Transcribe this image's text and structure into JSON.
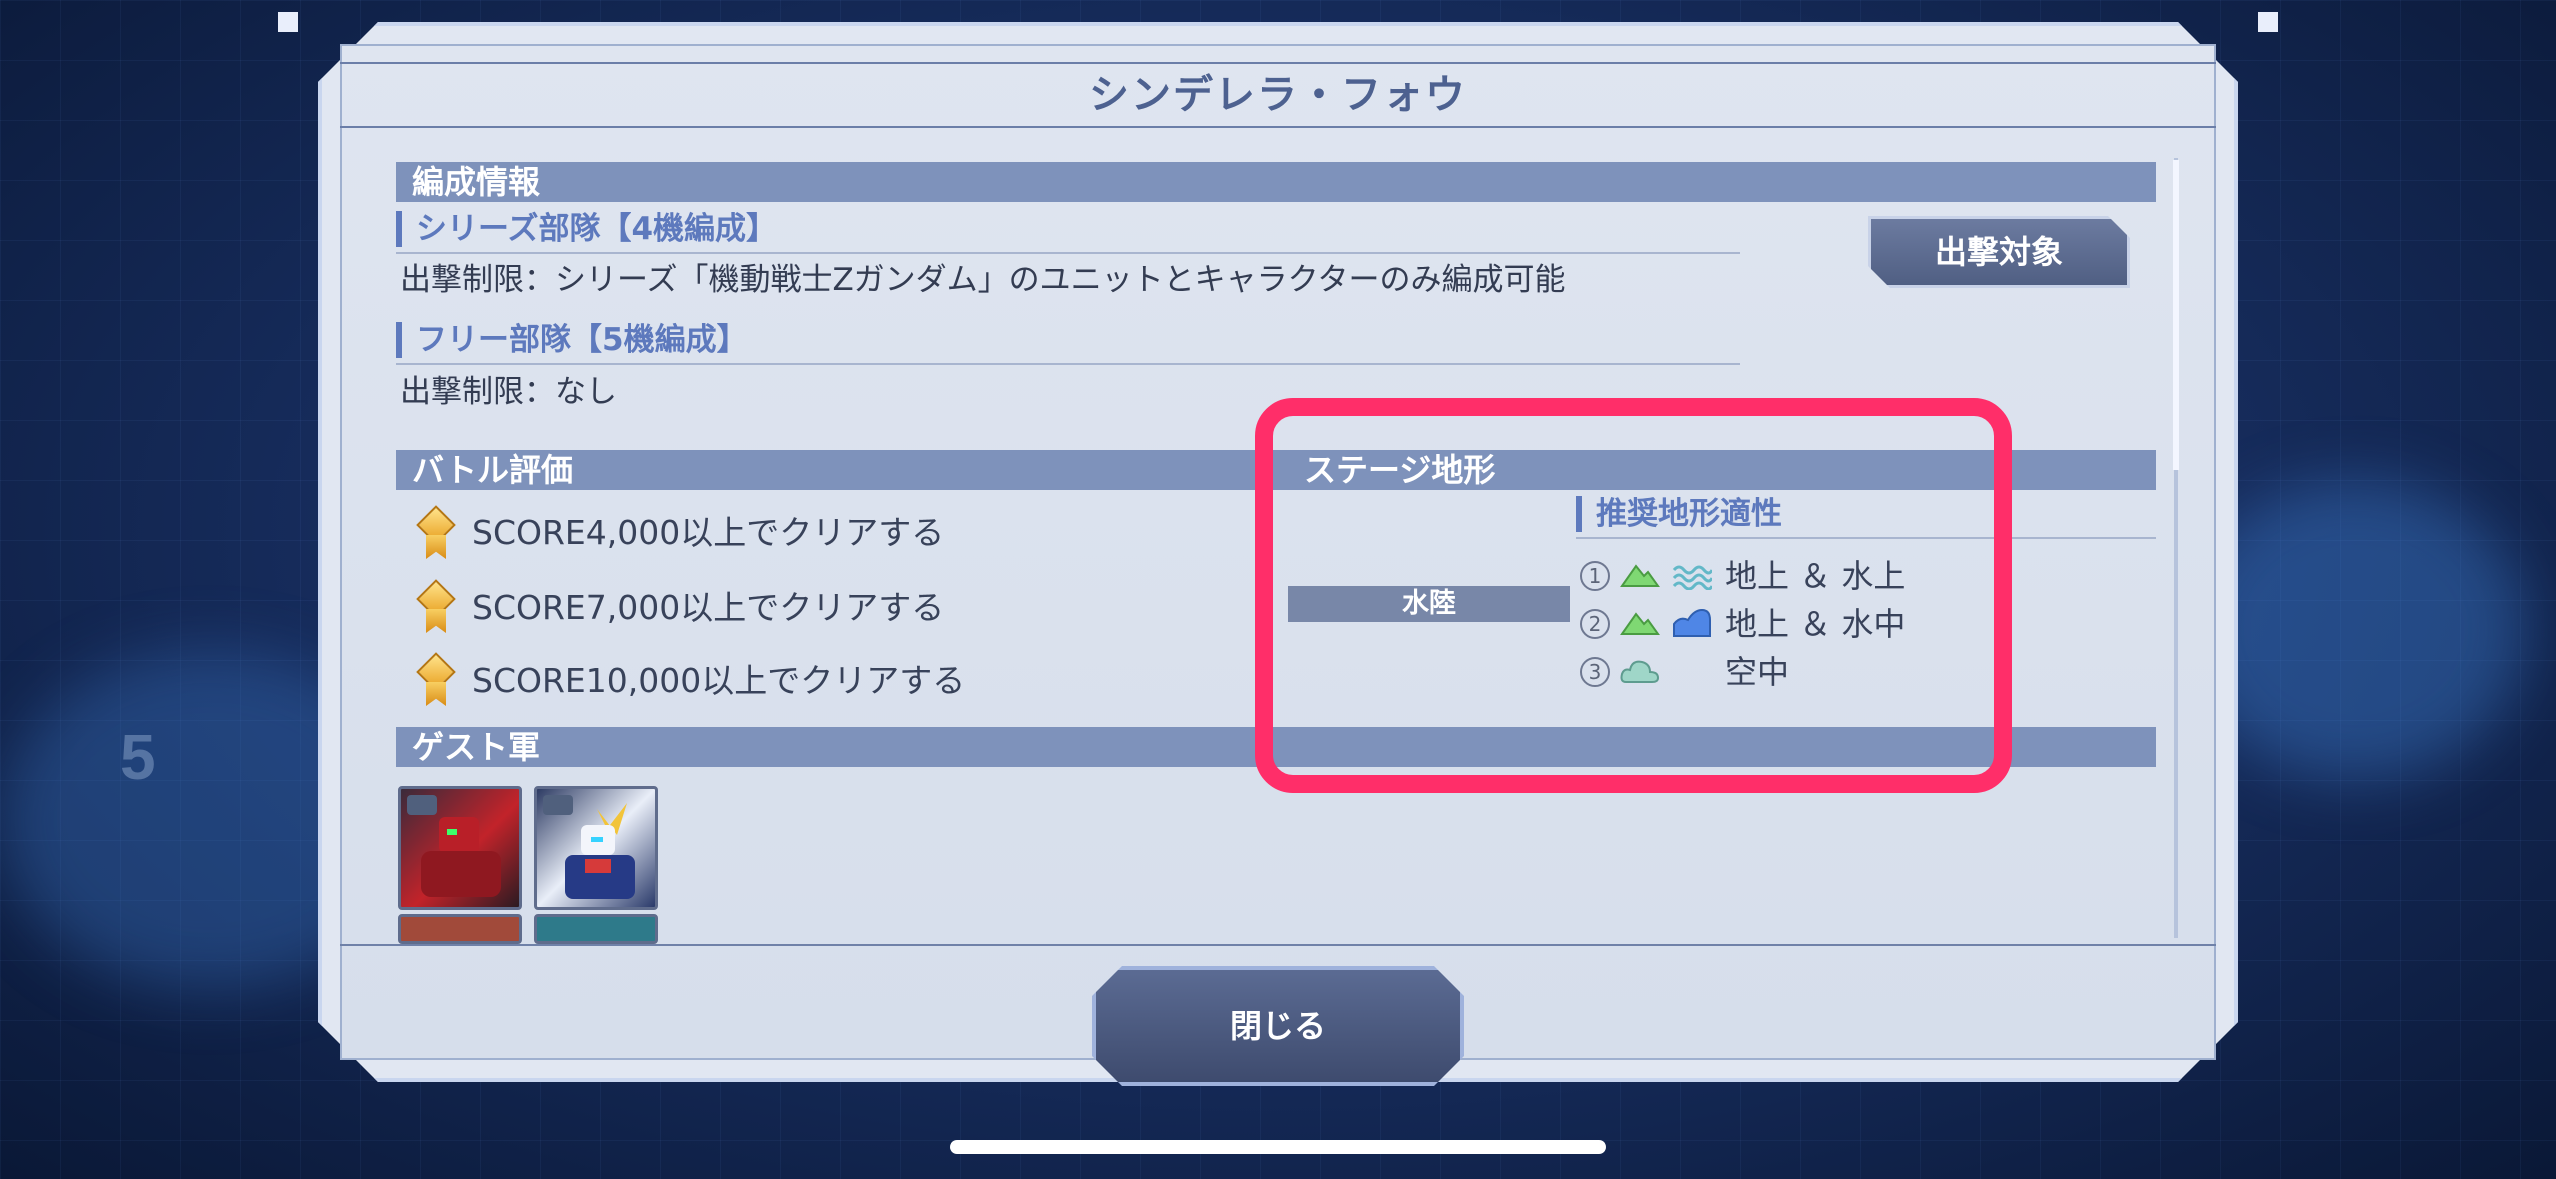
{
  "dialog": {
    "title": "シンデレラ・フォウ",
    "close_label": "閉じる",
    "sortie_label": "出撃対象"
  },
  "formation": {
    "header": "編成情報",
    "series_squad": {
      "label": "シリーズ部隊【4機編成】",
      "restriction": "出撃制限：シリーズ「機動戦士Zガンダム」のユニットとキャラクターのみ編成可能"
    },
    "free_squad": {
      "label": "フリー部隊【5機編成】",
      "restriction": "出撃制限：なし"
    }
  },
  "battle_eval": {
    "header": "バトル評価",
    "conditions": [
      "SCORE4,000以上でクリアする",
      "SCORE7,000以上でクリアする",
      "SCORE10,000以上でクリアする"
    ]
  },
  "stage_terrain": {
    "header": "ステージ地形",
    "terrain": "水陸",
    "recommended_header": "推奨地形適性",
    "recommendations": [
      {
        "num": "①",
        "icons": [
          "ground-icon",
          "water-surface-icon"
        ],
        "text": "地上 ＆ 水上"
      },
      {
        "num": "②",
        "icons": [
          "ground-icon",
          "underwater-icon"
        ],
        "text": "地上 ＆ 水中"
      },
      {
        "num": "③",
        "icons": [
          "air-icon"
        ],
        "text": "空中"
      }
    ]
  },
  "guest": {
    "header": "ゲスト軍"
  },
  "colors": {
    "highlight": "#ff2e69",
    "section_header": "#7e92bb",
    "accent_text": "#5d79bd"
  }
}
